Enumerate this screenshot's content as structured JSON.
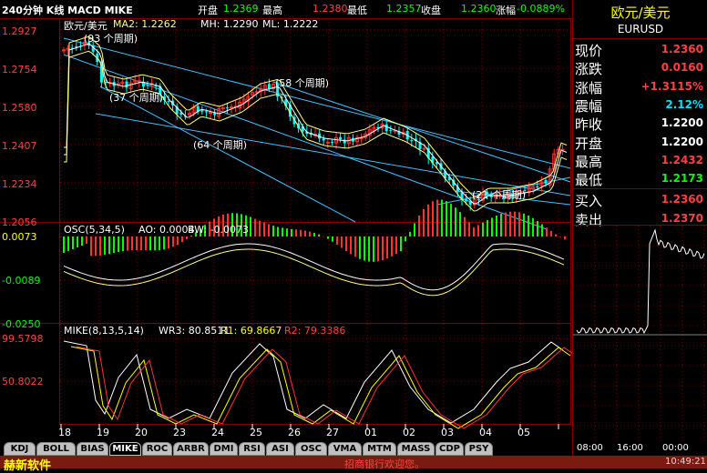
{
  "header": {
    "title": "240分钟 K线 MACD MIKE",
    "open_label": "开盘",
    "open_value": "1.2369",
    "high_label": "最高",
    "high_value": "1.2380",
    "low_label": "最低",
    "low_value": "1.2357",
    "close_label": "收盘",
    "close_value": "1.2360",
    "change_label": "涨幅",
    "change_value": "-0.0889%"
  },
  "main_panel": {
    "legend_name": "欧元/美元",
    "ma2": "MA2: 1.2262",
    "mh": "MH: 1.2290",
    "ml": "ML: 1.2222",
    "y_ticks": [
      "1.2927",
      "1.2754",
      "1.2580",
      "1.2407",
      "1.2234",
      "1.2056"
    ],
    "annotations": [
      "(93 个周期)",
      "(37 个周期)",
      "(64 个周期)",
      "(58 个周期)",
      "(21 个周期)"
    ]
  },
  "osc_panel": {
    "label": "OSC(5,34,5)",
    "ao": "AO: 0.0004",
    "bw": "BW: -0.0073",
    "y_ticks": [
      "0.0073",
      "-0.0089",
      "-0.0250"
    ]
  },
  "mike_panel": {
    "label": "MIKE(8,13,5,14)",
    "wr3": "WR3: 80.8511",
    "r1": "R1: 69.8667",
    "r2": "R2: 79.3386",
    "y_ticks": [
      "99.5798",
      "50.8022"
    ]
  },
  "x_axis_labels": [
    "18",
    "19",
    "20",
    "23",
    "24",
    "25",
    "26",
    "27",
    "01",
    "02",
    "03",
    "04",
    "05"
  ],
  "tabs": [
    {
      "label": "KDJ",
      "active": false
    },
    {
      "label": "BOLL",
      "active": false
    },
    {
      "label": "BIAS",
      "active": false
    },
    {
      "label": "MIKE",
      "active": true
    },
    {
      "label": "ROC",
      "active": false
    },
    {
      "label": "ARBR",
      "active": false
    },
    {
      "label": "DMI",
      "active": false
    },
    {
      "label": "RSI",
      "active": false
    },
    {
      "label": "ASI",
      "active": false
    },
    {
      "label": "OSC",
      "active": false
    },
    {
      "label": "VMA",
      "active": false
    },
    {
      "label": "MTM",
      "active": false
    },
    {
      "label": "MASS",
      "active": false
    },
    {
      "label": "CDP",
      "active": false
    },
    {
      "label": "PSY",
      "active": false
    }
  ],
  "quote": {
    "name": "欧元/美元",
    "code": "EURUSD",
    "rows": [
      {
        "label": "现价",
        "value": "1.2360",
        "color": "#ff4040"
      },
      {
        "label": "涨跌",
        "value": "0.0160",
        "color": "#ff4040"
      },
      {
        "label": "涨幅",
        "value": "+1.3115%",
        "color": "#ff4040"
      },
      {
        "label": "震幅",
        "value": "2.12%",
        "color": "#00e0ff"
      },
      {
        "label": "昨收",
        "value": "1.2200",
        "color": "#ffffff"
      },
      {
        "label": "开盘",
        "value": "1.2200",
        "color": "#ffffff"
      },
      {
        "label": "最高",
        "value": "1.2432",
        "color": "#ff4040"
      },
      {
        "label": "最低",
        "value": "1.2173",
        "color": "#00ff00"
      },
      {
        "label": "买入",
        "value": "1.2360",
        "color": "#ff4040"
      },
      {
        "label": "卖出",
        "value": "1.2370",
        "color": "#ff4040"
      }
    ]
  },
  "intraday_time_labels": [
    "08:00",
    "16:00",
    "00:00"
  ],
  "bottom_bar": {
    "brand": "赫新软件",
    "ticker": "招商银行欢迎您。",
    "clock": "10:49:21"
  },
  "colors": {
    "up": "#ff3030",
    "down": "#00ffff",
    "osc_up": "#ff3030",
    "osc_down": "#00ff00",
    "grid": "#800000",
    "ma": "#ffffff",
    "band": "#ffff80",
    "trendline": "#40c0ff"
  }
}
